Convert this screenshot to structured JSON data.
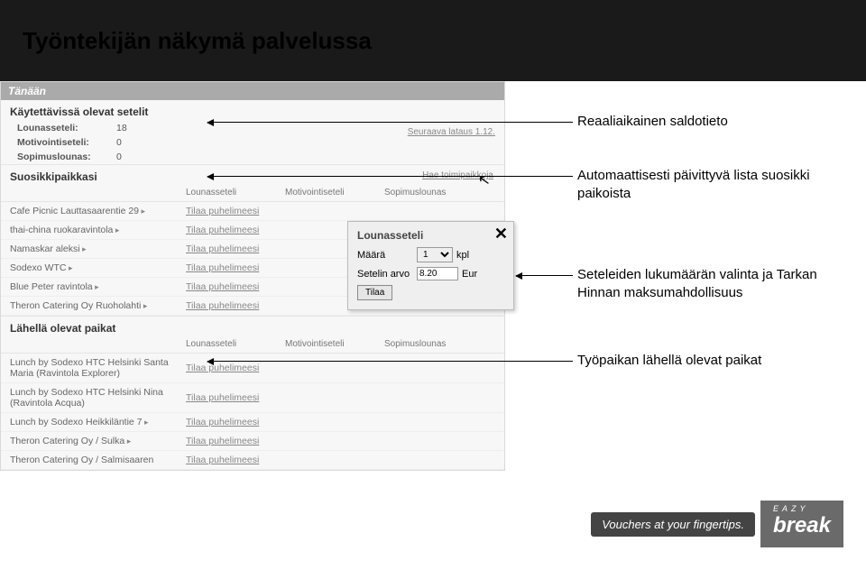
{
  "page": {
    "title": "Työntekijän näkymä palvelussa"
  },
  "tab": {
    "label": "Tänään"
  },
  "balance": {
    "heading": "Käytettävissä olevat setelit",
    "next_load": "Seuraava lataus 1.12.",
    "rows": [
      {
        "label": "Lounasseteli:",
        "value": "18"
      },
      {
        "label": "Motivointiseteli:",
        "value": "0"
      },
      {
        "label": "Sopimuslounas:",
        "value": "0"
      }
    ]
  },
  "columns": {
    "c1": "",
    "c2": "Lounasseteli",
    "c3": "Motivointiseteli",
    "c4": "Sopimuslounas"
  },
  "favorites": {
    "heading": "Suosikkipaikkasi",
    "more_link": "Hae toimipaikkoja",
    "order_label": "Tilaa puhelimeesi",
    "rows": [
      {
        "name": "Cafe Picnic Lauttasaarentie 29"
      },
      {
        "name": "thai-china ruokaravintola"
      },
      {
        "name": "Namaskar aleksi"
      },
      {
        "name": "Sodexo WTC"
      },
      {
        "name": "Blue Peter ravintola"
      },
      {
        "name": "Theron Catering Oy Ruoholahti"
      }
    ]
  },
  "nearby": {
    "heading": "Lähellä olevat paikat",
    "order_label": "Tilaa puhelimeesi",
    "rows": [
      {
        "name": "Lunch by Sodexo HTC Helsinki Santa Maria (Ravintola Explorer)"
      },
      {
        "name": "Lunch by Sodexo HTC Helsinki Nina (Ravintola Acqua)"
      },
      {
        "name": "Lunch by Sodexo Heikkiläntie 7"
      },
      {
        "name": "Theron Catering Oy / Sulka"
      },
      {
        "name": "Theron Catering Oy / Salmisaaren"
      }
    ]
  },
  "popup": {
    "title": "Lounasseteli",
    "qty_label": "Määrä",
    "qty_value": "1",
    "qty_unit": "kpl",
    "value_label": "Setelin arvo",
    "value": "8.20",
    "value_unit": "Eur",
    "submit": "Tilaa"
  },
  "annotations": {
    "a1": "Reaaliaikainen saldotieto",
    "a2": "Automaattisesti päivittyvä lista suosikki paikoista",
    "a3": "Seteleiden lukumäärän valinta ja Tarkan Hinnan maksumahdollisuus",
    "a4": "Työpaikan lähellä olevat paikat"
  },
  "logo": {
    "tagline": "Vouchers at your fingertips.",
    "small": "EAZY",
    "big": "break"
  }
}
